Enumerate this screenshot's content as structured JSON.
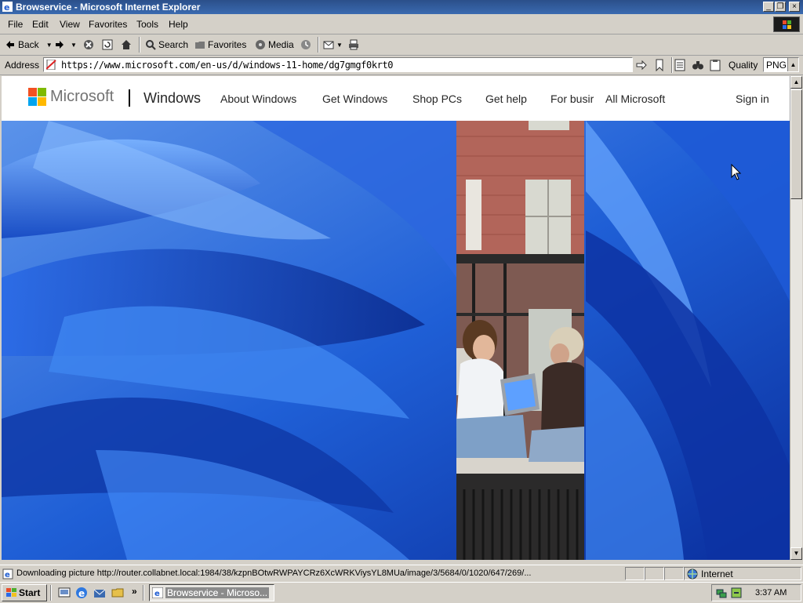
{
  "window": {
    "title": "Browservice - Microsoft Internet Explorer",
    "minimize_glyph": "_",
    "restore_glyph": "❐",
    "close_glyph": "×"
  },
  "menu": [
    "File",
    "Edit",
    "View",
    "Favorites",
    "Tools",
    "Help"
  ],
  "toolbar": {
    "back_label": "Back",
    "search_label": "Search",
    "favorites_label": "Favorites",
    "media_label": "Media"
  },
  "address": {
    "label": "Address",
    "url": "https://www.microsoft.com/en-us/d/windows-11-home/dg7gmgf0krt0",
    "quality_label": "Quality",
    "quality_value": "PNG"
  },
  "site": {
    "logo_text": "Microsoft",
    "product": "Windows",
    "nav": [
      "About Windows",
      "Get Windows",
      "Shop PCs",
      "Get help",
      "For busir",
      "All Microsoft"
    ],
    "sign_in": "Sign in"
  },
  "status": {
    "text": "Downloading picture http://router.collabnet.local:1984/38/kzpnBOtwRWPAYCRz6XcWRKViysYL8MUa/image/3/5684/0/1020/647/269/...",
    "zone": "Internet"
  },
  "taskbar": {
    "start": "Start",
    "overflow": "»",
    "task_label": "Browservice - Microso...",
    "clock": "3:37 AM"
  },
  "colors": {
    "ms_red": "#f25022",
    "ms_green": "#7fba00",
    "ms_blue": "#00a4ef",
    "ms_yellow": "#ffb900",
    "hero_blue": "#1f5fd6"
  },
  "icons": {
    "cursor": "arrow-cursor-icon"
  }
}
